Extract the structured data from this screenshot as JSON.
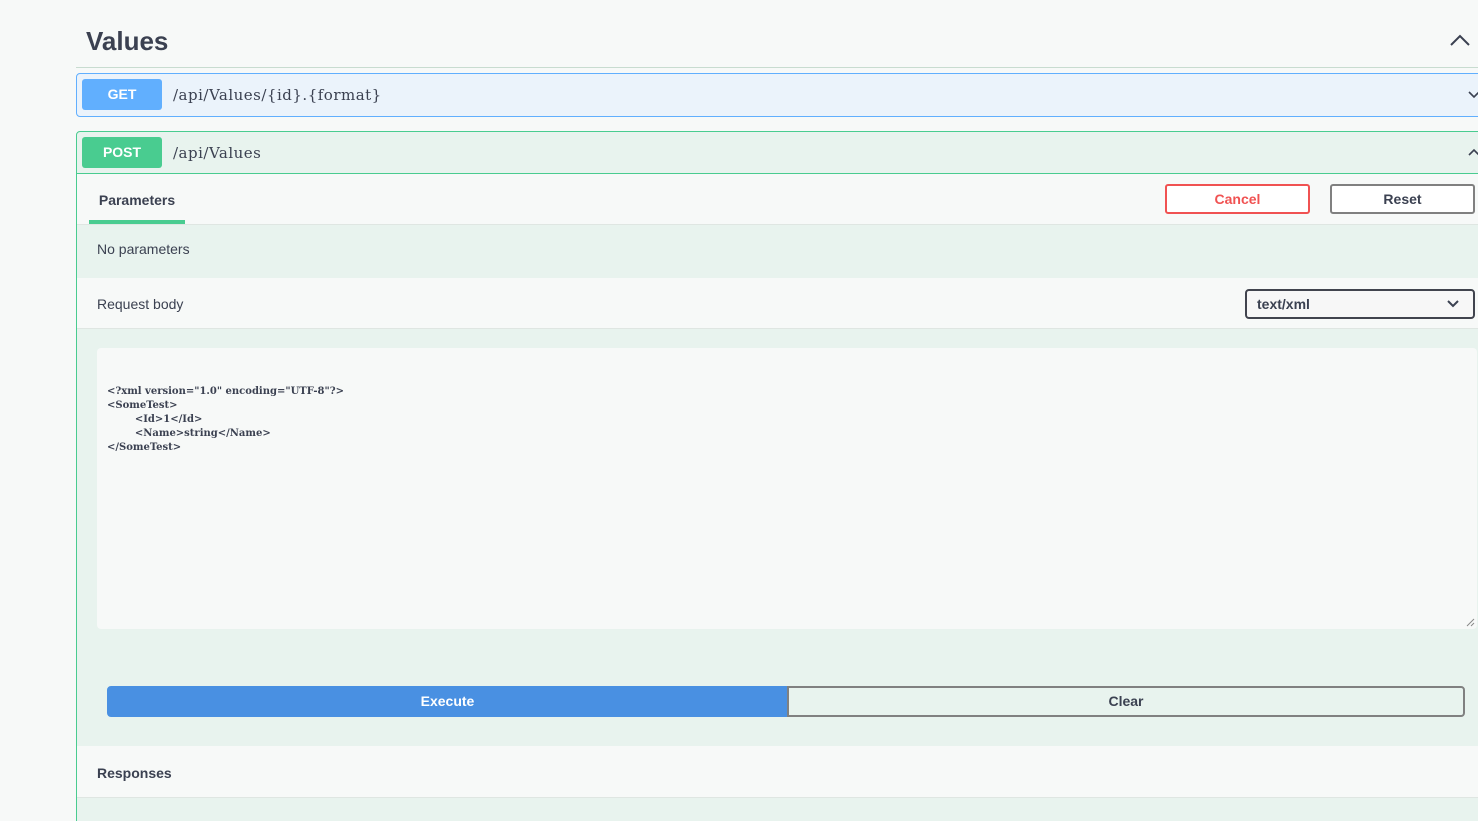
{
  "section": {
    "title": "Values",
    "collapse_icon": "chevron-up-icon"
  },
  "operations": [
    {
      "method": "GET",
      "path": "/api/Values/{id}.{format}",
      "color": "#61affe",
      "expanded": false
    },
    {
      "method": "POST",
      "path": "/api/Values",
      "color": "#49cc90",
      "expanded": true
    }
  ],
  "post_panel": {
    "tab_label": "Parameters",
    "cancel_label": "Cancel",
    "reset_label": "Reset",
    "no_params_text": "No parameters",
    "request_body_label": "Request body",
    "content_type": "text/xml",
    "body_text": "<?xml version=\"1.0\" encoding=\"UTF-8\"?>\n<SomeTest>\n\t<Id>1</Id>\n\t<Name>string</Name>\n</SomeTest>",
    "execute_label": "Execute",
    "clear_label": "Clear",
    "responses_label": "Responses"
  },
  "colors": {
    "get": "#61affe",
    "post": "#49cc90",
    "execute": "#4990e2",
    "cancel": "#f05252"
  }
}
